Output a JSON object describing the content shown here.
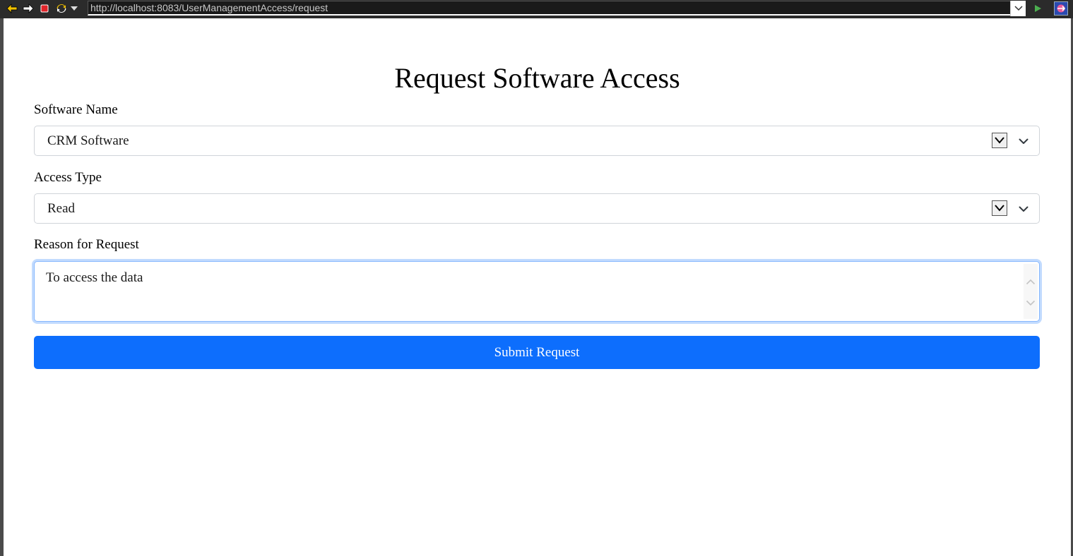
{
  "browser": {
    "url": "http://localhost:8083/UserManagementAccess/request",
    "icons": [
      "back-arrow-icon",
      "forward-arrow-icon",
      "stop-icon",
      "refresh-icon",
      "history-dropdown-icon",
      "url-dropdown-icon",
      "go-icon",
      "exit-icon"
    ],
    "colors": {
      "back": "#f0c000",
      "forward": "#ffffff",
      "stop": "#e0242a",
      "go": "#4caf50",
      "exit": "#3355cc"
    }
  },
  "page": {
    "title": "Request Software Access"
  },
  "form": {
    "software_name": {
      "label": "Software Name",
      "value": "CRM Software"
    },
    "access_type": {
      "label": "Access Type",
      "value": "Read"
    },
    "reason": {
      "label": "Reason for Request",
      "value": "To access the data"
    },
    "submit_label": "Submit Request"
  },
  "colors": {
    "primary": "#0d6efd",
    "focus_border": "#86b7fe",
    "input_border": "#d0d4d9"
  }
}
